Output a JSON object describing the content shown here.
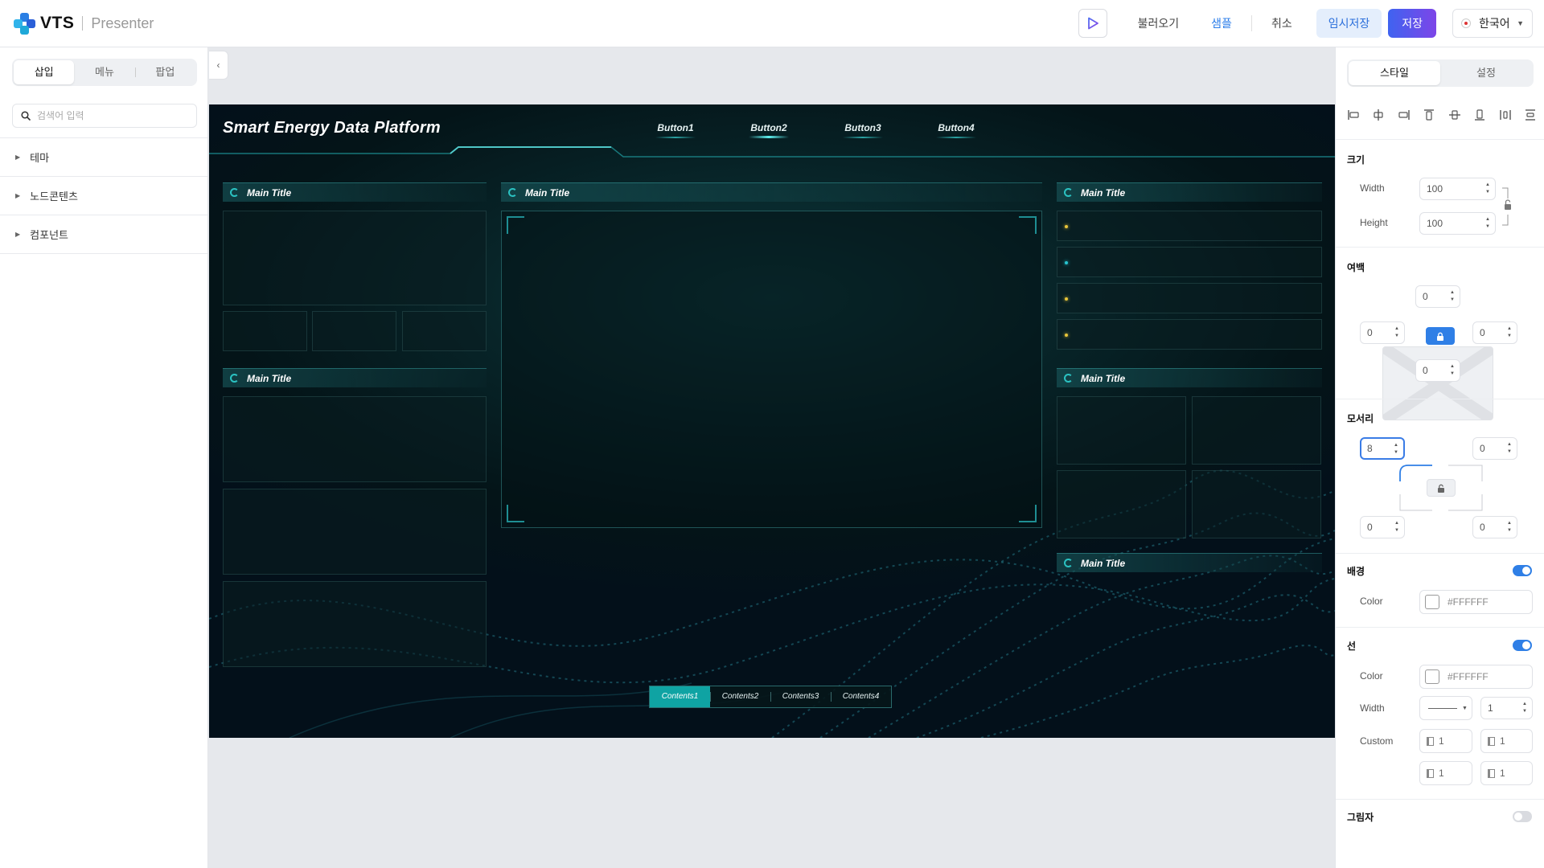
{
  "app": {
    "logo_text": "VTS",
    "product": "Presenter"
  },
  "toolbar": {
    "load": "불러오기",
    "sample": "샘플",
    "cancel": "취소",
    "temp_save": "임시저장",
    "save": "저장",
    "language": "한국어"
  },
  "left_panel": {
    "tabs": [
      "삽입",
      "메뉴",
      "팝업"
    ],
    "active_tab": "삽입",
    "search_placeholder": "검색어 입력",
    "tree": [
      "테마",
      "노드콘텐츠",
      "컴포넌트"
    ]
  },
  "dashboard": {
    "title": "Smart Energy Data Platform",
    "nav": [
      "Button1",
      "Button2",
      "Button3",
      "Button4"
    ],
    "active_nav": "Button2",
    "panel_title": "Main Title",
    "contents_tabs": [
      "Contents1",
      "Contents2",
      "Contents3",
      "Contents4"
    ],
    "active_contents": "Contents1",
    "dot_colors": [
      "#e8c53a",
      "#27c4cf",
      "#e8c53a",
      "#e8c53a"
    ]
  },
  "right_panel": {
    "tabs": [
      "스타일",
      "설정"
    ],
    "active_tab": "스타일",
    "size": {
      "title": "크기",
      "width_label": "Width",
      "width": "100",
      "height_label": "Height",
      "height": "100"
    },
    "margin": {
      "title": "여백",
      "top": "0",
      "left": "0",
      "right": "0",
      "bottom": "0"
    },
    "corner": {
      "title": "모서리",
      "top_left": "8",
      "top_right": "0",
      "bottom_left": "0",
      "bottom_right": "0"
    },
    "background": {
      "title": "배경",
      "enabled": true,
      "color_label": "Color",
      "color": "#FFFFFF"
    },
    "border": {
      "title": "선",
      "enabled": true,
      "color_label": "Color",
      "color": "#FFFFFF",
      "width_label": "Width",
      "width": "1",
      "custom_label": "Custom",
      "custom": [
        "1",
        "1",
        "1",
        "1"
      ]
    },
    "shadow": {
      "title": "그림자",
      "enabled": false
    }
  },
  "colors": {
    "accent": "#2f7fe6",
    "save_gradient_start": "#3f63f0",
    "save_gradient_end": "#7d45e8",
    "dashboard_teal": "#0fa3a3"
  }
}
